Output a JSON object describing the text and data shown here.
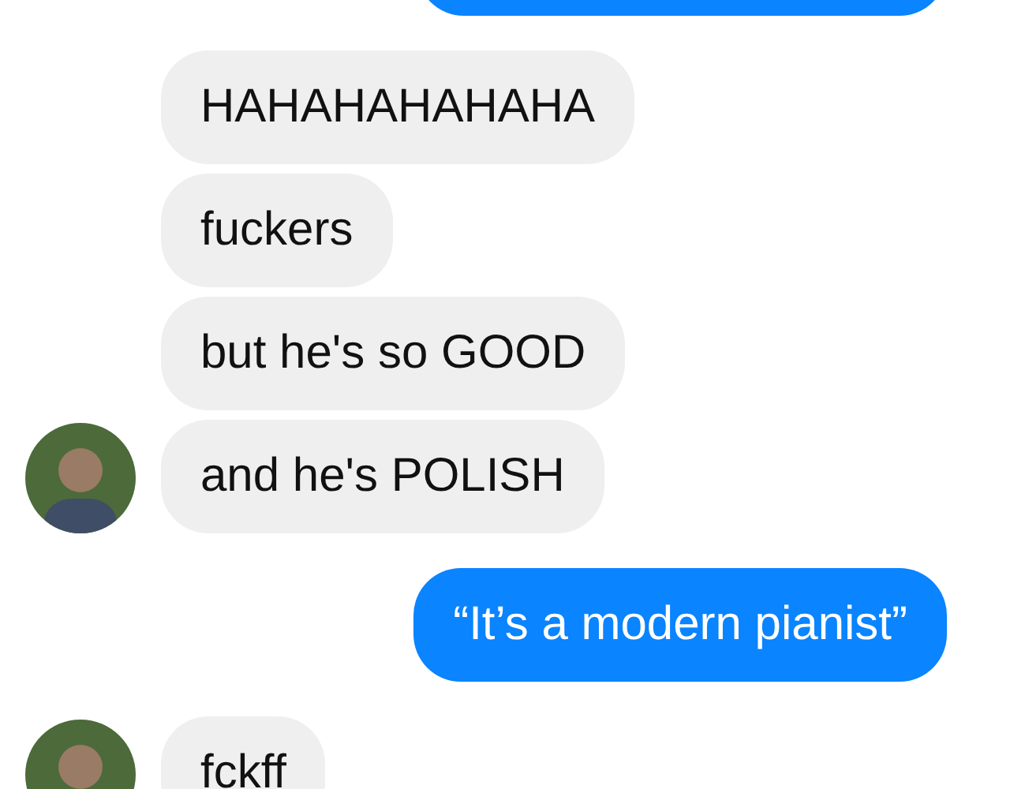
{
  "messages": [
    {
      "kind": "sent"
    },
    {
      "kind": "received",
      "text": "HAHAHAHAHAHA",
      "avatar": false
    },
    {
      "kind": "received",
      "text": "fuckers",
      "avatar": false
    },
    {
      "kind": "received",
      "text": "but he's so GOOD",
      "avatar": false
    },
    {
      "kind": "received",
      "text": "and he's POLISH",
      "avatar": true
    },
    {
      "kind": "sent",
      "text": "“It’s a modern pianist”"
    },
    {
      "kind": "received",
      "text": "fckff",
      "avatar": true
    }
  ]
}
